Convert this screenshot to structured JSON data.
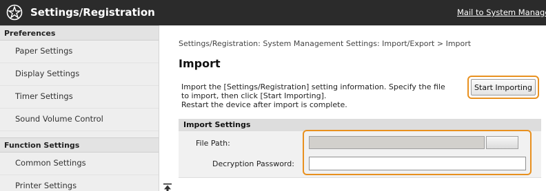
{
  "header": {
    "title": "Settings/Registration",
    "mail_link": "Mail to System Manager",
    "logo_icon": "gear-star-icon"
  },
  "sidebar": {
    "preferences_label": "Preferences",
    "preferences_items": [
      {
        "label": "Paper Settings"
      },
      {
        "label": "Display Settings"
      },
      {
        "label": "Timer Settings"
      },
      {
        "label": "Sound Volume Control"
      }
    ],
    "function_label": "Function Settings",
    "function_items": [
      {
        "label": "Common Settings"
      },
      {
        "label": "Printer Settings"
      }
    ]
  },
  "main": {
    "breadcrumb": "Settings/Registration: System Management Settings: Import/Export > Import",
    "title": "Import",
    "description_lines": [
      "Import the [Settings/Registration] setting information. Specify the file",
      "to import, then click [Start Importing].",
      "Restart the device after import is complete."
    ],
    "start_button": "Start Importing",
    "section_title": "Import Settings",
    "file_path_label": "File Path:",
    "file_path_value": "",
    "browse_label": "",
    "password_label": "Decryption Password:",
    "password_value": "",
    "scroll_top_icon": "scroll-to-top-icon"
  },
  "colors": {
    "header_bg": "#2b2b2b",
    "highlight": "#e8901e",
    "sidebar_bg": "#eeeeee",
    "section_bg": "#dddddd"
  }
}
